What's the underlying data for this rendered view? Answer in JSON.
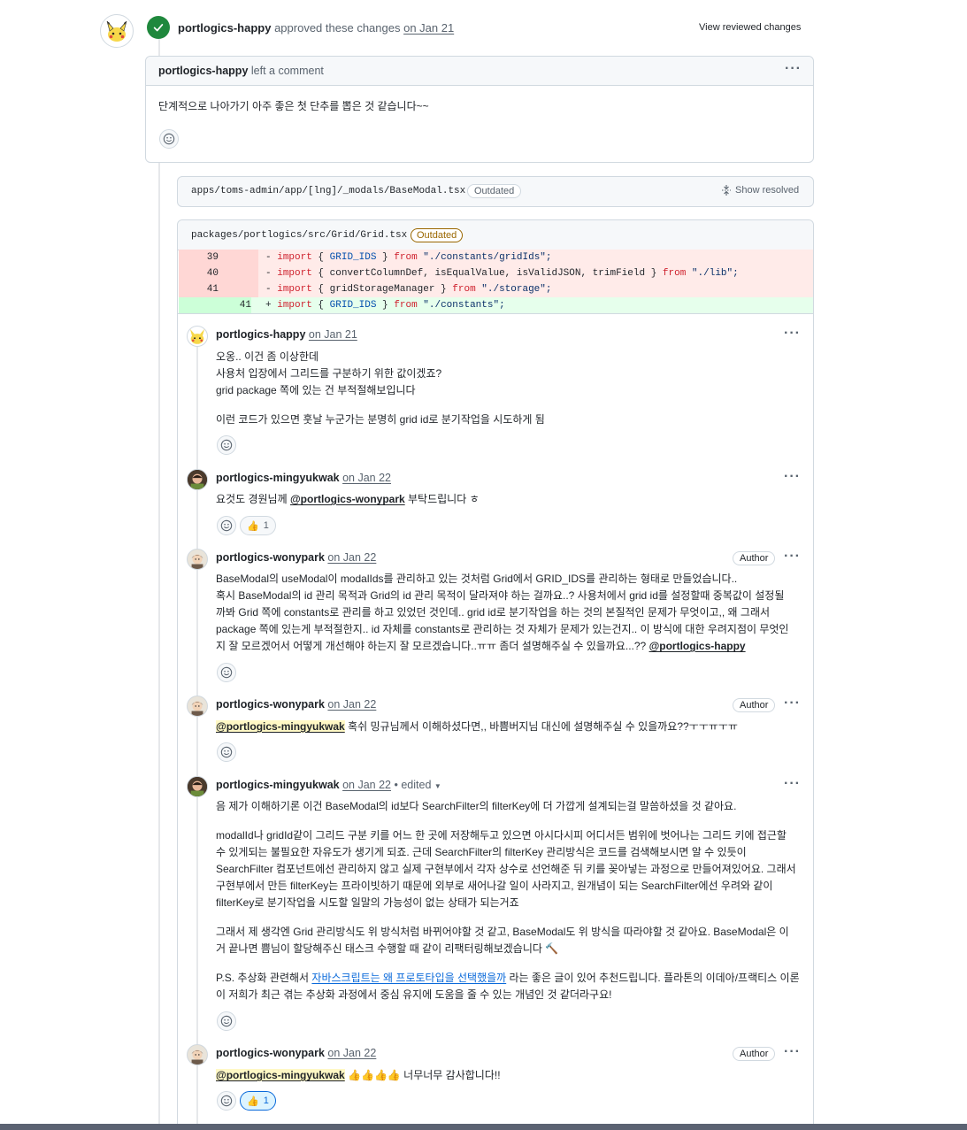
{
  "review": {
    "author": "portlogics-happy",
    "action_text": "approved these changes",
    "date": "on Jan 21",
    "view_button": "View reviewed changes"
  },
  "top_comment": {
    "author": "portlogics-happy",
    "action": "left a comment",
    "body": "단계적으로 나아가기 아주 좋은 첫 단추를 뽑은 것 같습니다~~"
  },
  "file1": {
    "path": "apps/toms-admin/app/[lng]/_modals/BaseModal.tsx",
    "badge": "Outdated",
    "show_resolved": "Show resolved"
  },
  "file2": {
    "path": "packages/portlogics/src/Grid/Grid.tsx",
    "badge": "Outdated",
    "lines": [
      {
        "old": "39",
        "new": "",
        "sign": "-",
        "type": "del"
      },
      {
        "old": "40",
        "new": "",
        "sign": "-",
        "type": "del"
      },
      {
        "old": "41",
        "new": "",
        "sign": "-",
        "type": "del"
      },
      {
        "old": "",
        "new": "41",
        "sign": "+",
        "type": "add"
      }
    ],
    "code": {
      "l1": {
        "kw": "import",
        "a": " { ",
        "id": "GRID_IDS",
        "b": " } ",
        "from": "from",
        "str": " \"./constants/gridIds\";"
      },
      "l2": {
        "kw": "import",
        "a": " { convertColumnDef, isEqualValue, isValidJSON, trimField } ",
        "from": "from",
        "str": " \"./lib\";"
      },
      "l3": {
        "kw": "import",
        "a": " { gridStorageManager } ",
        "from": "from",
        "str": " \"./storage\";"
      },
      "l4": {
        "kw": "import",
        "a": " { ",
        "id": "GRID_IDS",
        "b": " } ",
        "from": "from",
        "str": " \"./constants\";"
      }
    }
  },
  "thread": [
    {
      "author": "portlogics-happy",
      "date": "on Jan 21",
      "lines": [
        "오옹.. 이건 좀 이상한데",
        "사용처 입장에서 그리드를 구분하기 위한 값이겠죠?",
        "grid package 쪽에 있는 건 부적절해보입니다",
        "이런 코드가 있으면 훗날 누군가는 분명히 grid id로 분기작업을 시도하게 됨"
      ]
    },
    {
      "author": "portlogics-mingyukwak",
      "date": "on Jan 22",
      "pre": "요것도 경원님께 ",
      "mention": "@portlogics-wonypark",
      "post": " 부탁드립니다 ㅎ",
      "reaction": "👍",
      "reaction_count": "1"
    },
    {
      "author": "portlogics-wonypark",
      "date": "on Jan 22",
      "badge": "Author",
      "lines": [
        "BaseModal의 useModal이 modalIds를 관리하고 있는 것처럼 Grid에서 GRID_IDS를 관리하는 형태로 만들었습니다..",
        "혹시 BaseModal의 id 관리 목적과 Grid의 id 관리 목적이 달라져야 하는 걸까요..? 사용처에서 grid id를 설정할때 중복값이 설정될",
        "까봐 Grid 쪽에 constants로 관리를 하고 있었던 것인데.. grid id로 분기작업을 하는 것의 본질적인 문제가 무엇이고,, 왜 그래서",
        "package 쪽에 있는게 부적절한지.. id 자체를 constants로 관리하는 것 자체가 문제가 있는건지.. 이 방식에 대한 우려지점이 무엇인",
        "지 잘 모르겠어서 어떻게 개선해야 하는지 잘 모르겠습니다..ㅠㅠ 좀더 설명해주실 수 있을까요...?? "
      ],
      "mention": "@portlogics-happy"
    },
    {
      "author": "portlogics-wonypark",
      "date": "on Jan 22",
      "badge": "Author",
      "mention": "@portlogics-mingyukwak",
      "post": " 혹쉬 밍규님께서 이해하셨다면,, 바쁨버지님 대신에 설명해주실 수 있을까요??ㅜㅜㅠㅜㅠ"
    },
    {
      "author": "portlogics-mingyukwak",
      "date": "on Jan 22",
      "edited": "• edited",
      "p1": "음 제가 이해하기론 이건 BaseModal의 id보다 SearchFilter의 filterKey에 더 가깝게 설계되는걸 말씀하셨을 것 같아요.",
      "p2": [
        "modalId나 gridId같이 그리드 구분 키를 어느 한 곳에 저장해두고 있으면 아시다시피 어디서든 범위에 벗어나는 그리드 키에 접근할",
        "수 있게되는 불필요한 자유도가 생기게 되죠. 근데 SearchFilter의 filterKey 관리방식은 코드를 검색해보시면 알 수 있듯이",
        "SearchFilter 컴포넌트에선 관리하지 않고 실제 구현부에서 각자 상수로 선언해준 뒤 키를 꽂아넣는 과정으로 만들어져있어요. 그래서",
        "구현부에서 만든 filterKey는 프라이빗하기 때문에 외부로 새어나갈 일이 사라지고, 원개념이 되는 SearchFilter에선 우려와 같이",
        "filterKey로 분기작업을 시도할 일말의 가능성이 없는 상태가 되는거죠"
      ],
      "p3": [
        "그래서 제 생각엔 Grid 관리방식도 위 방식처럼 바뀌어야할 것 같고, BaseModal도 위 방식을 따라야할 것 같아요. BaseModal은 이",
        "거 끝나면 쁨님이 할당해주신 태스크 수행할 때 같이 리팩터링해보겠습니다 🔨"
      ],
      "p4_pre": "P.S. 추상화 관련해서 ",
      "p4_link": "자바스크립트는 왜 프로토타입을 선택했을까",
      "p4_post": " 라는 좋은 글이 있어 추천드립니다. 플라톤의 이데아/프랙티스 이론",
      "p4_line2": "이 저희가 최근 겪는 추상화 과정에서 중심 유지에 도움을 줄 수 있는 개념인 것 같더라구요!"
    },
    {
      "author": "portlogics-wonypark",
      "date": "on Jan 22",
      "badge": "Author",
      "mention": "@portlogics-mingyukwak",
      "post": " 👍👍👍👍 너무너무 감사합니다!!",
      "reaction": "👍",
      "reaction_count": "1"
    }
  ],
  "icons": {
    "check": "check-icon",
    "smiley": "smiley-icon",
    "more": "kebab-icon",
    "expand": "unfold-icon"
  },
  "colors": {
    "approve_green": "#1f883d",
    "outdated": "#9a6700",
    "link": "#0969da",
    "mention_highlight": "#fff8c5"
  }
}
